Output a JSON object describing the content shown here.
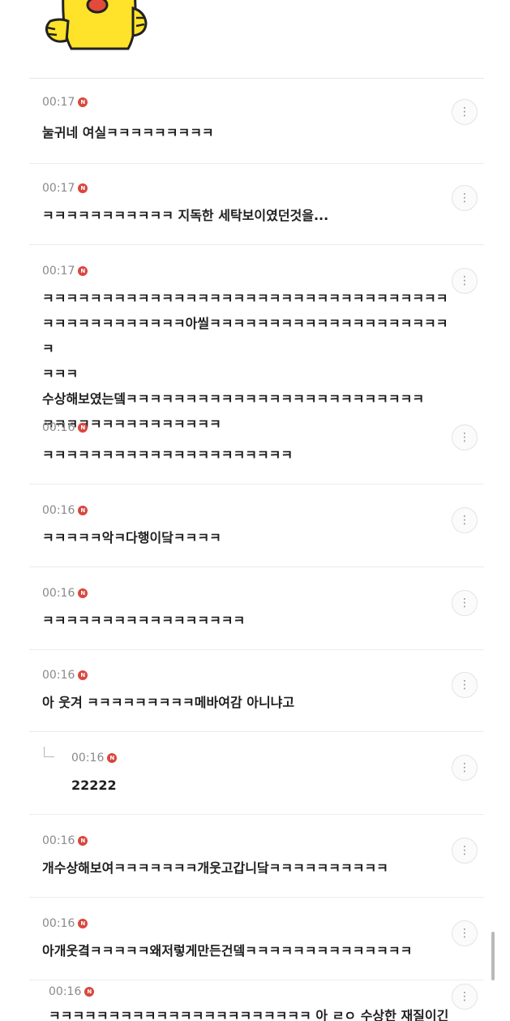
{
  "comments": [
    {
      "time": "00:17",
      "text": "눌귀네 여실ㅋㅋㅋㅋㅋㅋㅋㅋㅋ",
      "reply": false
    },
    {
      "time": "00:17",
      "text": "ㅋㅋㅋㅋㅋㅋㅋㅋㅋㅋㅋ 지독한 세탁보이였던것을...",
      "reply": false
    },
    {
      "time": "00:17",
      "text": "ㅋㅋㅋㅋㅋㅋㅋㅋㅋㅋㅋㅋㅋㅋㅋㅋㅋㅋㅋㅋㅋㅋㅋㅋㅋㅋㅋㅋㅋㅋㅋㅋㅋㅋ\nㅋㅋㅋㅋㅋㅋㅋㅋㅋㅋㅋㅋ아씰ㅋㅋㅋㅋㅋㅋㅋㅋㅋㅋㅋㅋㅋㅋㅋㅋㅋㅋㅋㅋㅋ\nㅋㅋㅋ\n수상해보였는뎈ㅋㅋㅋㅋㅋㅋㅋㅋㅋㅋㅋㅋㅋㅋㅋㅋㅋㅋㅋㅋㅋㅋㅋㅋㅋ\nㅋㅋㅋㅋㅋㅋㅋㅋㅋㅋㅋㅋㅋㅋㅋ",
      "reply": false
    },
    {
      "time": "00:16",
      "text": "ㅋㅋㅋㅋㅋㅋㅋㅋㅋㅋㅋㅋㅋㅋㅋㅋㅋㅋㅋㅋㅋ",
      "reply": false
    },
    {
      "time": "00:16",
      "text": "ㅋㅋㅋㅋㅋ악ㅋ다행이닼ㅋㅋㅋㅋ",
      "reply": false
    },
    {
      "time": "00:16",
      "text": "ㅋㅋㅋㅋㅋㅋㅋㅋㅋㅋㅋㅋㅋㅋㅋㅋㅋ",
      "reply": false
    },
    {
      "time": "00:16",
      "text": "아 웃겨 ㅋㅋㅋㅋㅋㅋㅋㅋㅋ메바여감 아니냐고",
      "reply": false
    },
    {
      "time": "00:16",
      "text": "22222",
      "reply": true
    },
    {
      "time": "00:16",
      "text": "개수상해보여ㅋㅋㅋㅋㅋㅋㅋ개웃고갑니닼ㅋㅋㅋㅋㅋㅋㅋㅋㅋㅋ",
      "reply": false
    },
    {
      "time": "00:16",
      "text": "아개웃곀ㅋㅋㅋㅋㅋ왜저렇게만든건뎈ㅋㅋㅋㅋㅋㅋㅋㅋㅋㅋㅋㅋㅋㅋ",
      "reply": false
    },
    {
      "time": "00:16",
      "text": "ㅋㅋㅋㅋㅋㅋㅋㅋㅋㅋㅋㅋㅋㅋㅋㅋㅋㅋㅋㅋㅋㅋ 아 ㄹㅇ 수상한 재질이긴",
      "reply": false
    }
  ],
  "icons": {
    "more": "more-vertical-icon",
    "new": "new-badge-icon",
    "reply": "reply-arrow-icon"
  },
  "colors": {
    "badge": "#d8473f",
    "time": "#8a8a8a",
    "text": "#1f1f1f"
  }
}
